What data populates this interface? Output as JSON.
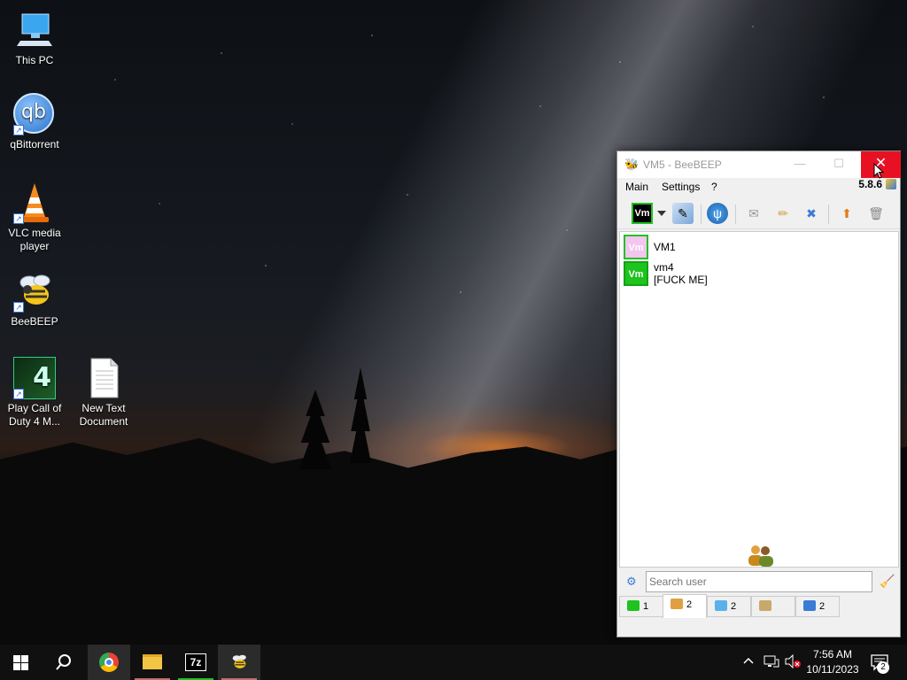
{
  "desktop": {
    "icons": [
      {
        "label": "This PC"
      },
      {
        "label": "qBittorrent"
      },
      {
        "label": "VLC media player"
      },
      {
        "label": "BeeBEEP"
      },
      {
        "label": "Play Call of Duty 4 M..."
      },
      {
        "label": "New Text Document"
      }
    ],
    "qbittorrent_glyph": "qb",
    "cod_glyph": "4"
  },
  "window": {
    "title": "VM5 - BeeBEEP",
    "version": "5.8.6",
    "menu": [
      "Main",
      "Settings",
      "?"
    ],
    "toolbar": {
      "vm_button": "Vm",
      "icons": [
        "edit-profile-icon",
        "network-icon",
        "inbox-icon",
        "write-icon",
        "tools-icon",
        "update-icon",
        "trash-icon"
      ]
    },
    "users": [
      {
        "avatar": "Vm",
        "name": "VM1",
        "status": "",
        "color": "#f3c5f0"
      },
      {
        "avatar": "Vm",
        "name": "vm4",
        "status": "[FUCK ME]",
        "color": "#1ec31e"
      }
    ],
    "search_placeholder": "Search user",
    "tabs": [
      {
        "count": "1",
        "icon": "user-icon"
      },
      {
        "count": "2",
        "icon": "users-icon"
      },
      {
        "count": "2",
        "icon": "chat-icon"
      },
      {
        "count": "",
        "icon": "group-icon"
      },
      {
        "count": "2",
        "icon": "share-icon"
      }
    ]
  },
  "taskbar": {
    "sevenzip_label": "7z",
    "time": "7:56 AM",
    "date": "10/11/2023",
    "notification_count": "2"
  },
  "colors": {
    "close_red": "#e81123",
    "vm_green": "#1ec31e",
    "taskbar": "#101010"
  }
}
